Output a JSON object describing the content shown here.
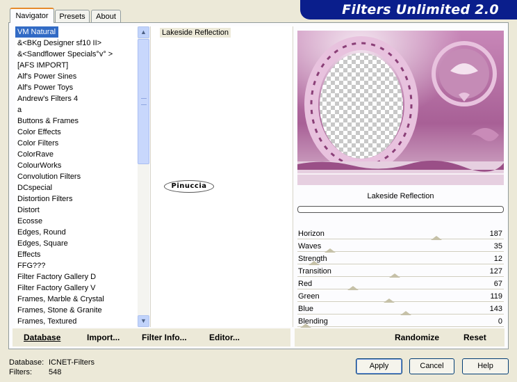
{
  "app": {
    "title": "Filters Unlimited 2.0"
  },
  "tabs": [
    {
      "label": "Navigator",
      "active": true
    },
    {
      "label": "Presets",
      "active": false
    },
    {
      "label": "About",
      "active": false
    }
  ],
  "filter_list": {
    "items": [
      "VM Natural",
      "&<BKg Designer sf10 II>",
      "&<Sandflower Specials°v° >",
      "[AFS IMPORT]",
      "Alf's Power Sines",
      "Alf's Power Toys",
      "Andrew's Filters 4",
      "a",
      "Buttons & Frames",
      "Color Effects",
      "Color Filters",
      "ColorRave",
      "ColourWorks",
      "Convolution Filters",
      "DCspecial",
      "Distortion Filters",
      "Distort",
      "Ecosse",
      "Edges, Round",
      "Edges, Square",
      "Effects",
      "FFG???",
      "Filter Factory Gallery D",
      "Filter Factory Gallery V",
      "Frames, Marble & Crystal",
      "Frames, Stone & Granite",
      "Frames, Textured"
    ],
    "selected_index": 0
  },
  "subfilter": {
    "selected": "Lakeside Reflection"
  },
  "watermark": {
    "text": "Pinuccia"
  },
  "preview": {
    "filter_name": "Lakeside Reflection",
    "progress": 0
  },
  "params": [
    {
      "name": "Horizon",
      "value": 187
    },
    {
      "name": "Waves",
      "value": 35
    },
    {
      "name": "Strength",
      "value": 12
    },
    {
      "name": "Transition",
      "value": 127
    },
    {
      "name": "Red",
      "value": 67
    },
    {
      "name": "Green",
      "value": 119
    },
    {
      "name": "Blue",
      "value": 143
    },
    {
      "name": "Blending",
      "value": 0
    }
  ],
  "left_actions": {
    "database": "Database",
    "import": "Import...",
    "filter_info": "Filter Info...",
    "editor": "Editor..."
  },
  "right_actions": {
    "randomize": "Randomize",
    "reset": "Reset"
  },
  "status": {
    "database_label": "Database:",
    "database_value": "ICNET-Filters",
    "filters_label": "Filters:",
    "filters_value": "548"
  },
  "dialog_buttons": {
    "apply": "Apply",
    "cancel": "Cancel",
    "help": "Help"
  },
  "colors": {
    "banner": "#0a1e8c",
    "selection": "#316ac5",
    "preview_tint": "#b0709e"
  }
}
